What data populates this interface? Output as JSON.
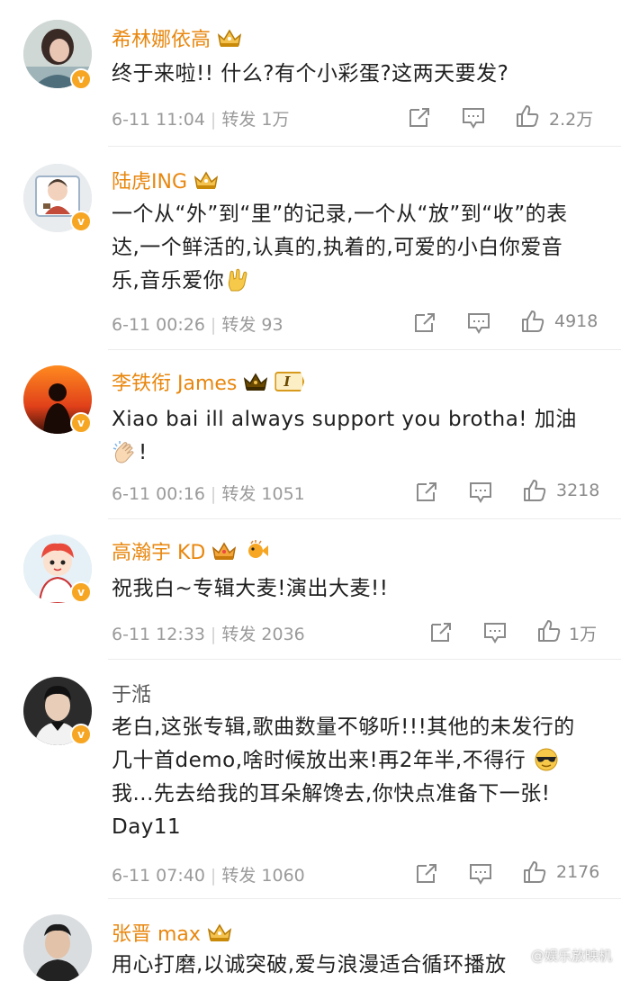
{
  "comments": [
    {
      "author": "希林娜依高",
      "author_color": "#e8870f",
      "text": "终于来啦!!  什么?有个小彩蛋?这两天要发?",
      "time": "6-11 11:04",
      "repost_label": "转发",
      "reposts": "1万",
      "likes": "2.2万"
    },
    {
      "author": "陆虎ING",
      "author_color": "#e8870f",
      "text": "一个从“外”到“里”的记录,一个从“放”到“收”的表达,一个鲜活的,认真的,执着的,可爱的小白你爱音乐,音乐爱你",
      "time": "6-11 00:26",
      "repost_label": "转发",
      "reposts": "93",
      "likes": "4918"
    },
    {
      "author": "李铁衔 James",
      "author_color": "#e8870f",
      "level_badge": "I",
      "text": "Xiao bai ill always support you brotha! 加油",
      "text_line2": "!",
      "time": "6-11 00:16",
      "repost_label": "转发",
      "reposts": "1051",
      "likes": "3218"
    },
    {
      "author": "高瀚宇 KD",
      "author_color": "#e8870f",
      "text": "祝我白~专辑大麦!演出大麦!!",
      "time": "6-11 12:33",
      "repost_label": "转发",
      "reposts": "2036",
      "likes": "1万"
    },
    {
      "author": "于湉",
      "author_color": "#555555",
      "text_a": "老白,这张专辑,歌曲数量不够听!!!其他的未发行的几十首demo,啥时候放出来!再2年半,不得行",
      "text_b": "我...先去给我的耳朵解馋去,你快点准备下一张! Day11",
      "time": "6-11 07:40",
      "repost_label": "转发",
      "reposts": "1060",
      "likes": "2176"
    },
    {
      "author": "张晋 max",
      "author_color": "#e8870f",
      "text": "用心打磨,以诚突破,爱与浪漫适合循环播放"
    }
  ],
  "watermark": "@娱乐放映机",
  "verified_badge": "v"
}
